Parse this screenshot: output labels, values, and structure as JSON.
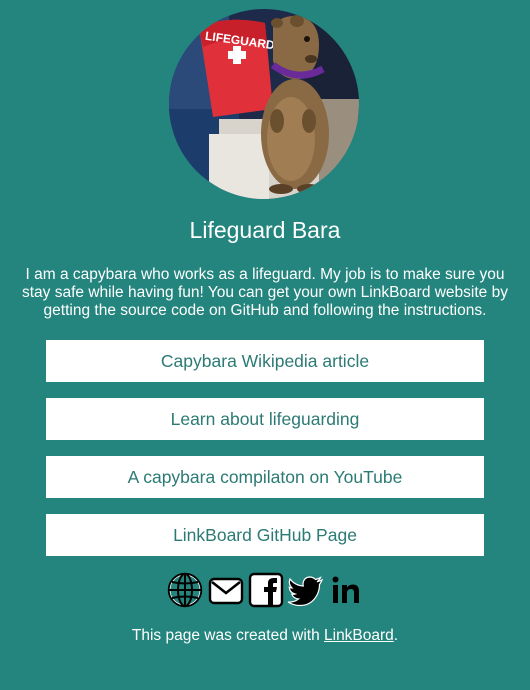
{
  "profile": {
    "name": "Lifeguard Bara",
    "bio": "I am a capybara who works as a lifeguard. My job is to make sure you stay safe while having fun! You can get your own LinkBoard website by getting the source code on GitHub and following the instructions.",
    "avatar_stand_text": "LIFEGUARD"
  },
  "links": [
    {
      "label": "Capybara Wikipedia article"
    },
    {
      "label": "Learn about lifeguarding"
    },
    {
      "label": "A capybara compilaton on YouTube"
    },
    {
      "label": "LinkBoard GitHub Page"
    }
  ],
  "socials": [
    {
      "icon": "globe-icon"
    },
    {
      "icon": "mail-icon"
    },
    {
      "icon": "facebook-icon"
    },
    {
      "icon": "twitter-icon"
    },
    {
      "icon": "linkedin-icon",
      "text": "in"
    }
  ],
  "footer": {
    "prefix": "This page was created with ",
    "link_label": "LinkBoard",
    "suffix": "."
  },
  "colors": {
    "background": "#23857d",
    "button_bg": "#ffffff",
    "button_text": "#2c7a74"
  }
}
